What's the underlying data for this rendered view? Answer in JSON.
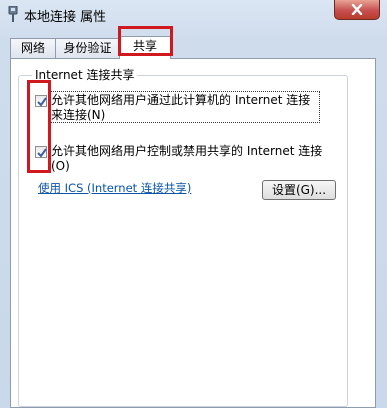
{
  "window": {
    "title": "本地连接 属性",
    "icon": "network-adapter-icon"
  },
  "tabs": [
    {
      "label": "网络"
    },
    {
      "label": "身份验证"
    },
    {
      "label": "共享",
      "active": true
    }
  ],
  "sharing": {
    "group_title": "Internet 连接共享",
    "options": [
      {
        "line1": "允许其他网络用户通过此计算机的 Internet 连接",
        "line2": "来连接(N)",
        "checked": true
      },
      {
        "line1": "允许其他网络用户控制或禁用共享的 Internet 连接",
        "line2": "(O)",
        "checked": true
      }
    ],
    "ics_link": "使用 ICS (Internet 连接共享)",
    "settings_button": "设置(G)..."
  },
  "colors": {
    "highlight_red": "#d0181e",
    "link_blue": "#0b54a8",
    "close_button": "#c75050"
  }
}
